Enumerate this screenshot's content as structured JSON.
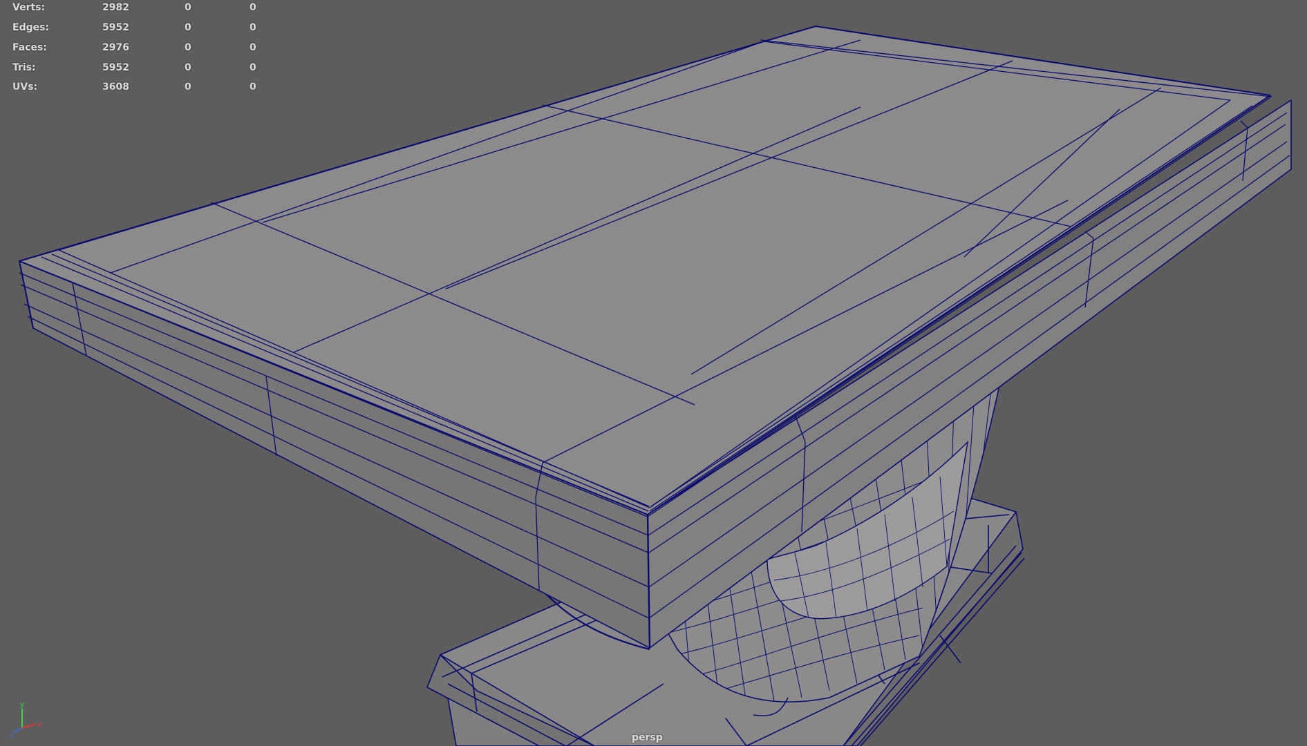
{
  "stats": [
    {
      "label": "Verts:",
      "values": [
        "2982",
        "0",
        "0"
      ]
    },
    {
      "label": "Edges:",
      "values": [
        "5952",
        "0",
        "0"
      ]
    },
    {
      "label": "Faces:",
      "values": [
        "2976",
        "0",
        "0"
      ]
    },
    {
      "label": "Tris:",
      "values": [
        "5952",
        "0",
        "0"
      ]
    },
    {
      "label": "UVs:",
      "values": [
        "3608",
        "0",
        "0"
      ]
    }
  ],
  "camera": "persp",
  "axis": {
    "x": "x",
    "y": "y",
    "z": "z"
  },
  "colors": {
    "background": "#5d5d5d",
    "surface_top": "#8a8a8a",
    "surface_side": "#7d7d7d",
    "surface_light": "#a0a0a0",
    "wire": "#0a0a6e",
    "hud_text": "#dcdcdc",
    "axis_x": "#d83a3a",
    "axis_y": "#3ad84a",
    "axis_z": "#3a6ad8"
  },
  "icons": {
    "axis_gizmo": "xyz-axis-icon"
  }
}
